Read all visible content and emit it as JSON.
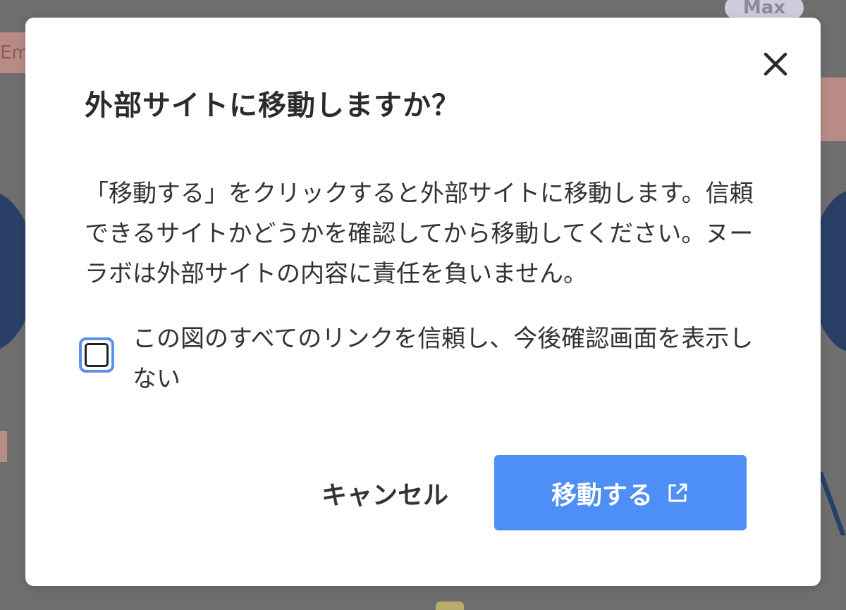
{
  "background": {
    "pill_label": "Max",
    "tag_label": "Em"
  },
  "dialog": {
    "title": "外部サイトに移動しますか？",
    "message": "「移動する」をクリックすると外部サイトに移動します。信頼できるサイトかどうかを確認してから移動してください。ヌーラボは外部サイトの内容に責任を負いません。",
    "checkbox_label": "この図のすべてのリンクを信頼し、今後確認画面を表示しない",
    "checkbox_checked": false,
    "cancel_label": "キャンセル",
    "confirm_label": "移動する",
    "close_icon": "close-icon",
    "confirm_icon": "external-link-icon"
  },
  "colors": {
    "primary": "#4d8ef7",
    "overlay": "#6e6e6e",
    "checkbox_focus": "#5b8ff0"
  }
}
